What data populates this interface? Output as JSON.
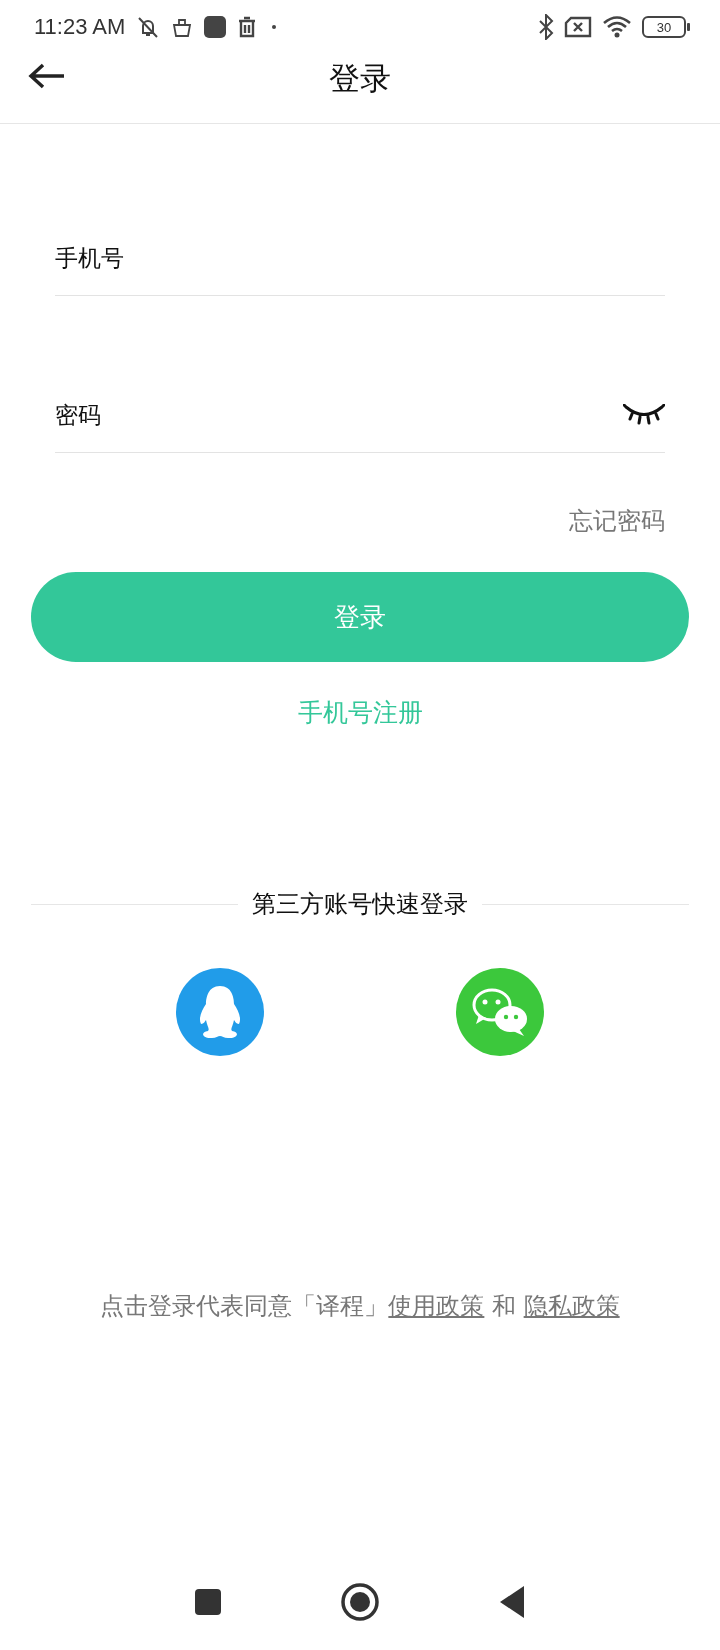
{
  "status_bar": {
    "time": "11:23 AM",
    "battery": "30"
  },
  "header": {
    "title": "登录"
  },
  "phone_field": {
    "placeholder": "手机号"
  },
  "password_field": {
    "placeholder": "密码",
    "password_visible": false
  },
  "forgot_link": "忘记密码",
  "login_button": "登录",
  "register_link": "手机号注册",
  "third_party": {
    "title": "第三方账号快速登录",
    "providers": [
      {
        "kind": "qq",
        "color": "#219ce9"
      },
      {
        "kind": "wechat",
        "color": "#3cc83c"
      }
    ]
  },
  "agreement": {
    "text": "点击登录代表同意「译程」",
    "links": [
      "使用政策",
      "隐私政策"
    ],
    "conjunction": "和"
  }
}
